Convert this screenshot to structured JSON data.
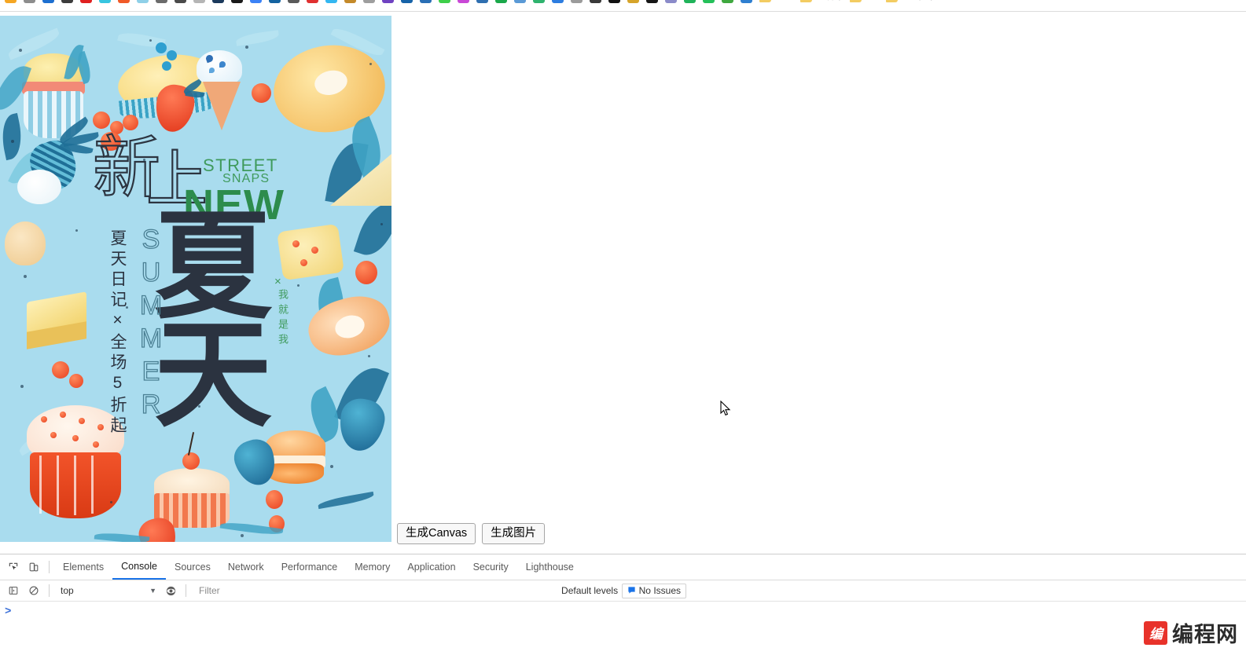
{
  "browser": {
    "bookmarks": [
      {
        "label": "",
        "icon": "app-icon",
        "color": "#f5a623"
      },
      {
        "label": "",
        "icon": "app-icon",
        "color": "#8d8d8d"
      },
      {
        "label": "",
        "icon": "app-icon",
        "color": "#1d6fd0"
      },
      {
        "label": "",
        "icon": "app-icon",
        "color": "#3c3c3c"
      },
      {
        "label": "",
        "icon": "app-icon",
        "color": "#e02020"
      },
      {
        "label": "",
        "icon": "app-icon",
        "color": "#38c5e0"
      },
      {
        "label": "",
        "icon": "app-icon",
        "color": "#f05a28"
      },
      {
        "label": "",
        "icon": "app-icon",
        "color": "#8fd0e8"
      },
      {
        "label": "",
        "icon": "app-icon",
        "color": "#6b6b6b"
      },
      {
        "label": "",
        "icon": "app-icon",
        "color": "#4a4a4a"
      },
      {
        "label": "",
        "icon": "app-icon",
        "color": "#b5b5b5"
      },
      {
        "label": "",
        "icon": "app-icon",
        "color": "#1b3a5c"
      },
      {
        "label": "",
        "icon": "app-icon",
        "color": "#1a1a1a"
      },
      {
        "label": "",
        "icon": "app-icon",
        "color": "#3b82f6"
      },
      {
        "label": "",
        "icon": "app-icon",
        "color": "#1463a0"
      },
      {
        "label": "",
        "icon": "app-icon",
        "color": "#5a5a5a"
      },
      {
        "label": "",
        "icon": "app-icon",
        "color": "#e03030"
      },
      {
        "label": "",
        "icon": "app-icon",
        "color": "#34b7f1"
      },
      {
        "label": "",
        "icon": "app-icon",
        "color": "#c48a2a"
      },
      {
        "label": "",
        "icon": "app-icon",
        "color": "#9e9e9e"
      },
      {
        "label": "",
        "icon": "app-icon",
        "color": "#6f42c1"
      },
      {
        "label": "",
        "icon": "app-icon",
        "color": "#1763a8"
      },
      {
        "label": "",
        "icon": "app-icon",
        "color": "#2a6fb5"
      },
      {
        "label": "",
        "icon": "app-icon",
        "color": "#3ecf4a"
      },
      {
        "label": "",
        "icon": "app-icon",
        "color": "#c948d6"
      },
      {
        "label": "",
        "icon": "app-icon",
        "color": "#2f6fb0"
      },
      {
        "label": "",
        "icon": "app-icon",
        "color": "#1aa84a"
      },
      {
        "label": "",
        "icon": "app-icon",
        "color": "#5b9ad6"
      },
      {
        "label": "",
        "icon": "app-icon",
        "color": "#2fb36e"
      },
      {
        "label": "",
        "icon": "app-icon",
        "color": "#2d7de0"
      },
      {
        "label": "",
        "icon": "app-icon",
        "color": "#9b9b9b"
      },
      {
        "label": "",
        "icon": "app-icon",
        "color": "#3a3a3a"
      },
      {
        "label": "",
        "icon": "app-icon",
        "color": "#111111"
      },
      {
        "label": "",
        "icon": "app-icon",
        "color": "#d6a42a"
      },
      {
        "label": "",
        "icon": "app-icon",
        "color": "#161616"
      },
      {
        "label": "",
        "icon": "app-icon",
        "color": "#8b8bc9"
      },
      {
        "label": "",
        "icon": "app-icon",
        "color": "#20b35a"
      },
      {
        "label": "",
        "icon": "app-icon",
        "color": "#25c05a"
      },
      {
        "label": "",
        "icon": "app-icon",
        "color": "#3fa83f"
      },
      {
        "label": "",
        "icon": "app-icon",
        "color": "#2f7fd0"
      }
    ],
    "bookmark_folders": [
      {
        "label": "tools"
      },
      {
        "label": "UI设计"
      },
      {
        "label": "vue"
      },
      {
        "label": "web框架 Node"
      }
    ]
  },
  "poster": {
    "bg_color": "#a9dcee",
    "accent_green": "#3f9a5c",
    "dark_text": "#2b3340",
    "headline_cn_1": "新",
    "headline_cn_2": "上",
    "street": "STREET",
    "snaps": "SNAPS",
    "new": "NEW",
    "big_cn_1": "夏",
    "big_cn_2": "天",
    "vertical_sub": "夏天日记×全场5折起",
    "vertical_summer": "SUMMER",
    "vertical_slogan": "我就是我",
    "x_mark": "×"
  },
  "page_buttons": {
    "generate_canvas": "生成Canvas",
    "generate_image": "生成图片"
  },
  "devtools": {
    "tabs": [
      {
        "label": "Elements",
        "active": false
      },
      {
        "label": "Console",
        "active": true
      },
      {
        "label": "Sources",
        "active": false
      },
      {
        "label": "Network",
        "active": false
      },
      {
        "label": "Performance",
        "active": false
      },
      {
        "label": "Memory",
        "active": false
      },
      {
        "label": "Application",
        "active": false
      },
      {
        "label": "Security",
        "active": false
      },
      {
        "label": "Lighthouse",
        "active": false
      }
    ],
    "inspect_icon": "inspect-element-icon",
    "device_icon": "device-toolbar-icon",
    "console": {
      "clear_icon": "clear-console-icon",
      "sidebar_icon": "console-sidebar-icon",
      "eye_icon": "live-expression-icon",
      "context": "top",
      "context_caret": "▼",
      "filter_placeholder": "Filter",
      "levels_label": "Default levels",
      "levels_caret": "▼",
      "issues_label": "No Issues",
      "issues_icon": "issues-bubble-icon",
      "prompt_caret": ">",
      "prompt_value": ""
    }
  },
  "watermark": {
    "logo_text": "编",
    "text": "编程网",
    "logo_color": "#e8322a"
  }
}
